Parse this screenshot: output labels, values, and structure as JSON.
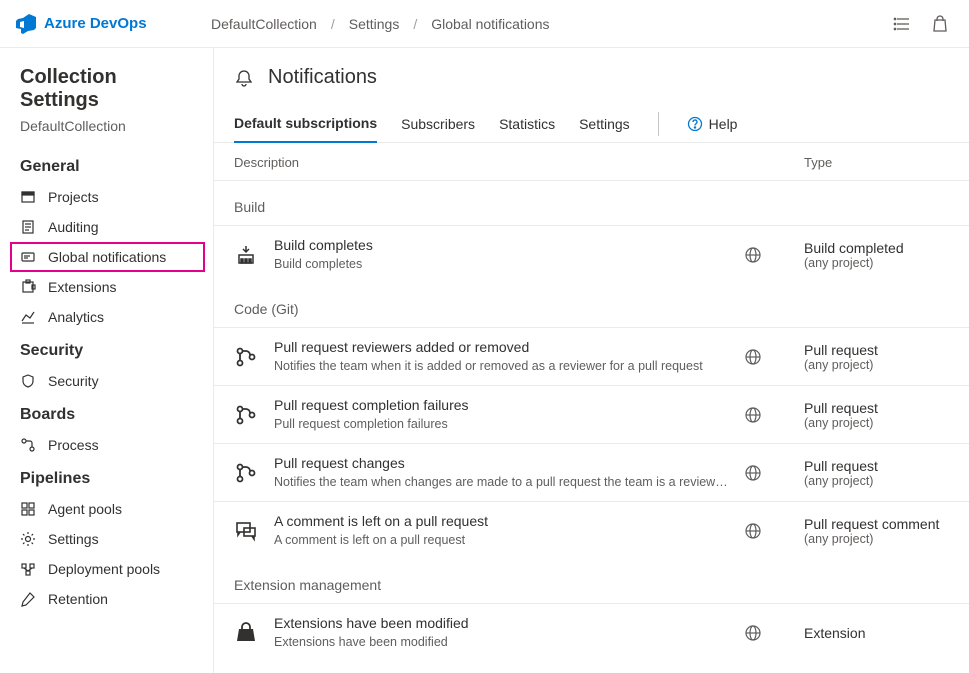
{
  "brand": "Azure DevOps",
  "breadcrumb": {
    "a": "DefaultCollection",
    "b": "Settings",
    "c": "Global notifications"
  },
  "sidebar": {
    "title": "Collection Settings",
    "subtitle": "DefaultCollection",
    "groups": [
      {
        "head": "General",
        "items": [
          {
            "label": "Projects"
          },
          {
            "label": "Auditing"
          },
          {
            "label": "Global notifications",
            "highlight": true
          },
          {
            "label": "Extensions"
          },
          {
            "label": "Analytics"
          }
        ]
      },
      {
        "head": "Security",
        "items": [
          {
            "label": "Security"
          }
        ]
      },
      {
        "head": "Boards",
        "items": [
          {
            "label": "Process"
          }
        ]
      },
      {
        "head": "Pipelines",
        "items": [
          {
            "label": "Agent pools"
          },
          {
            "label": "Settings"
          },
          {
            "label": "Deployment pools"
          },
          {
            "label": "Retention"
          }
        ]
      }
    ]
  },
  "page_title": "Notifications",
  "tabs": {
    "a": "Default subscriptions",
    "b": "Subscribers",
    "c": "Statistics",
    "d": "Settings",
    "help": "Help"
  },
  "columns": {
    "desc": "Description",
    "type": "Type"
  },
  "groups": [
    {
      "head": "Build",
      "rows": [
        {
          "title": "Build completes",
          "sub": "Build completes",
          "type": "Build completed",
          "scope": "(any project)"
        }
      ]
    },
    {
      "head": "Code (Git)",
      "rows": [
        {
          "title": "Pull request reviewers added or removed",
          "sub": "Notifies the team when it is added or removed as a reviewer for a pull request",
          "type": "Pull request",
          "scope": "(any project)"
        },
        {
          "title": "Pull request completion failures",
          "sub": "Pull request completion failures",
          "type": "Pull request",
          "scope": "(any project)"
        },
        {
          "title": "Pull request changes",
          "sub": "Notifies the team when changes are made to a pull request the team is a reviewer for",
          "type": "Pull request",
          "scope": "(any project)"
        },
        {
          "title": "A comment is left on a pull request",
          "sub": "A comment is left on a pull request",
          "type": "Pull request comment",
          "scope": "(any project)"
        }
      ]
    },
    {
      "head": "Extension management",
      "rows": [
        {
          "title": "Extensions have been modified",
          "sub": "Extensions have been modified",
          "type": "Extension",
          "scope": ""
        }
      ]
    }
  ]
}
